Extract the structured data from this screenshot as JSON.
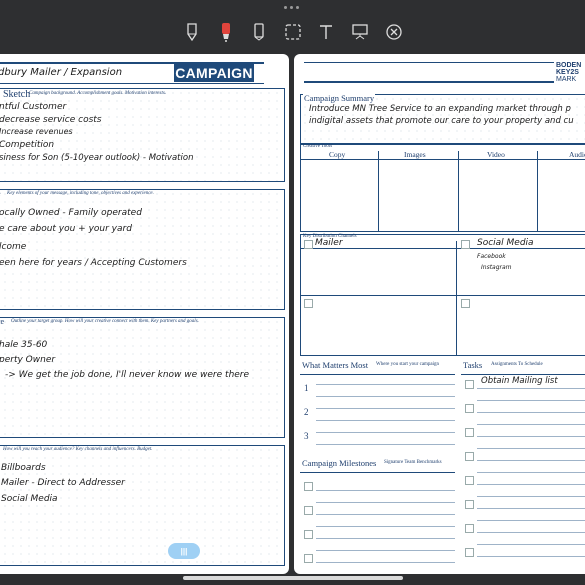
{
  "toolbar": {
    "tools": [
      "pen-icon",
      "marker-icon",
      "pencil-icon",
      "lasso-icon",
      "text-icon",
      "presentation-icon",
      "close-circle-icon"
    ],
    "active_tool": "marker-icon",
    "accent": "#e0443c"
  },
  "left_page": {
    "title_handwritten": "dbury Mailer / Expansion",
    "banner": "CAMPAIGN",
    "sections": [
      {
        "heading": "Sketch",
        "hint": "Campaign background. Accomplishment goals. Motivation interests.",
        "lines": [
          "ntful Customer",
          "decrease service costs",
          "Increase revenues",
          "Competition",
          "siness for Son (5-10year outlook) - Motivation"
        ]
      },
      {
        "heading": "e",
        "hint": "Key elements of your message, including tone, objectives and experience.",
        "lines": [
          "ocally Owned - Family operated",
          "e care about you + your yard",
          "lcome",
          "een here for years / Accepting Customers"
        ]
      },
      {
        "heading": "ce",
        "hint": "Outline your target group. How will your creative connect with them. Key partners and goals.",
        "lines": [
          "hale 35-60",
          "perty Owner",
          "-> We get the job done, I'll never know we were there"
        ]
      },
      {
        "heading": "",
        "hint": "How will you reach your audience? Key channels and influencers. Budget.",
        "lines": [
          "Billboards",
          "Mailer - Direct to Addresser",
          "Social Media"
        ]
      }
    ],
    "page_button": "|||"
  },
  "right_page": {
    "brand_lines": [
      "BODEN",
      "KEY2S",
      "MARK"
    ],
    "summary_label": "Campaign Summary",
    "summary_lines": [
      "Introduce MN Tree Service to an expanding market through p",
      "indigital assets that promote our care to your property and cu"
    ],
    "creative_tools_label": "Creative Tools",
    "creative_cols": [
      "Copy",
      "Images",
      "Video",
      "Audio"
    ],
    "distribution_label": "Key Distribution Channels",
    "channels": [
      {
        "label": "Mailer",
        "notes": []
      },
      {
        "label": "Social Media",
        "notes": [
          "Facebook",
          "Instagram"
        ]
      }
    ],
    "what_matters_label": "What Matters Most",
    "what_matters_hint": "Where you start your campaign",
    "what_matters_nums": [
      "1",
      "2",
      "3"
    ],
    "tasks_label": "Tasks",
    "tasks_hint": "Assignments To Schedule",
    "tasks": [
      "Obtain Mailing list"
    ],
    "milestones_label": "Campaign Milestones",
    "milestones_hint": "Signature Team Benchmarks"
  }
}
